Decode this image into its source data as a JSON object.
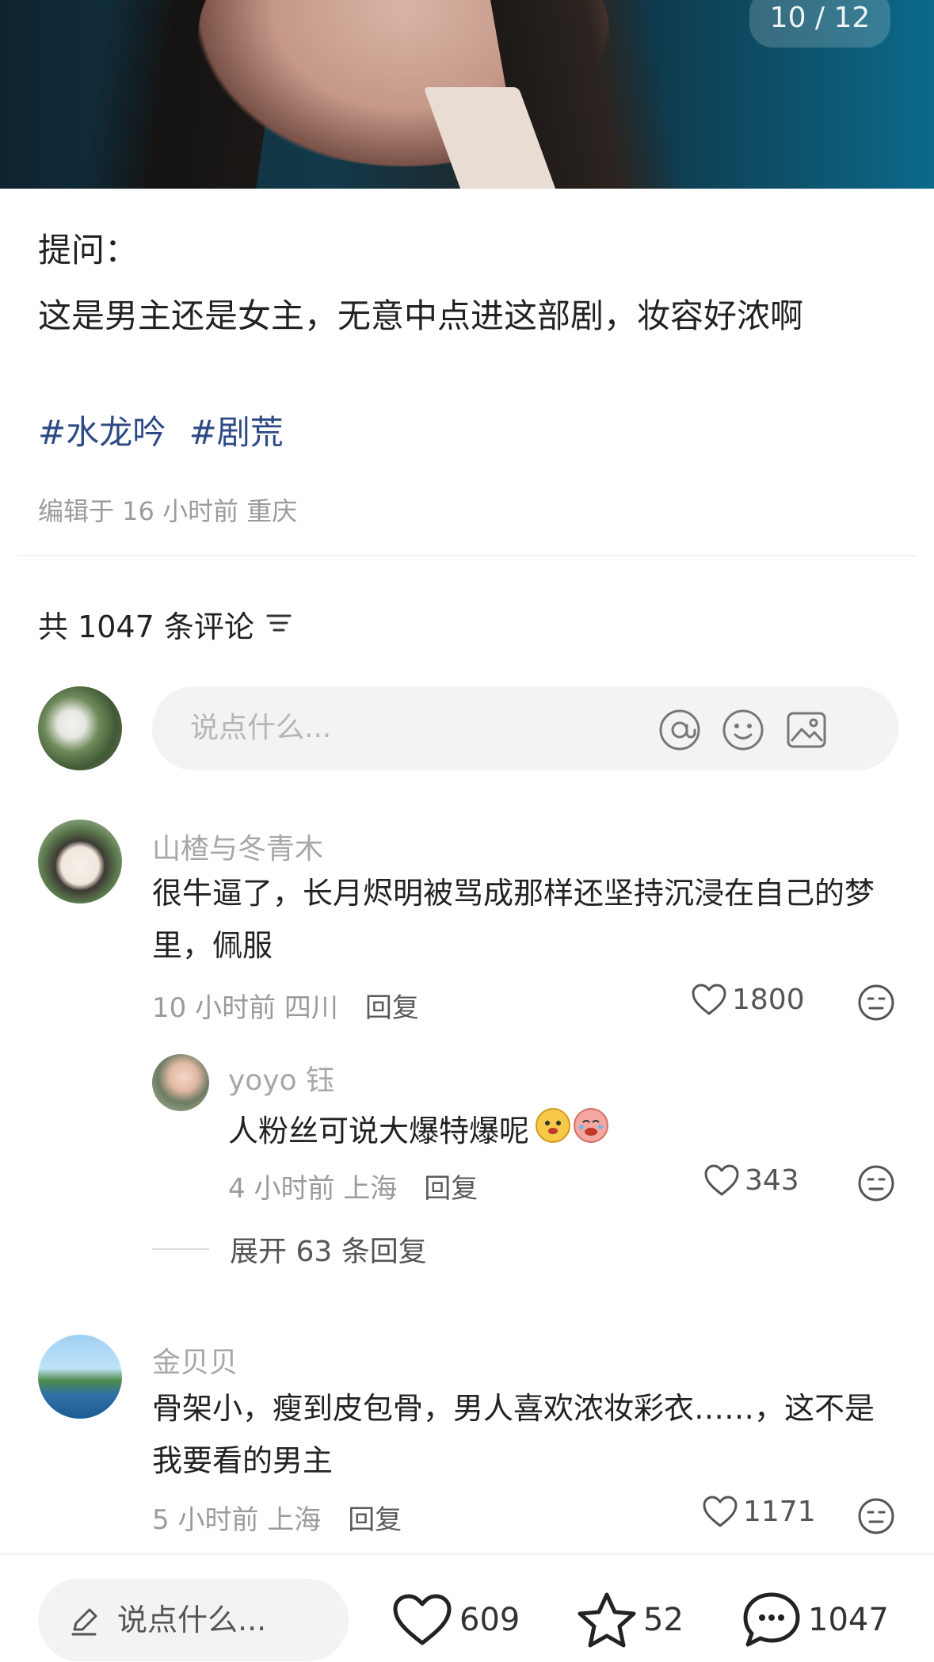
{
  "hero": {
    "page_counter": "10 / 12"
  },
  "post": {
    "label": "提问：",
    "body": "这是男主还是女主，无意中点进这部剧，妆容好浓啊",
    "tags": [
      "#水龙吟",
      "#剧荒"
    ],
    "meta": "编辑于 16 小时前 重庆"
  },
  "comments_header": {
    "title": "共 1047 条评论"
  },
  "comment_input": {
    "placeholder": "说点什么..."
  },
  "comments": [
    {
      "user": "山楂与冬青木",
      "text": "很牛逼了，长月烬明被骂成那样还坚持沉浸在自己的梦里，佩服",
      "time_location": "10 小时前 四川",
      "reply_label": "回复",
      "likes": "1800",
      "reply": {
        "user": "yoyo 钰",
        "text": "人粉丝可说大爆特爆呢",
        "time_location": "4 小时前 上海",
        "reply_label": "回复",
        "likes": "343"
      },
      "expand_label": "展开 63 条回复"
    },
    {
      "user": "金贝贝",
      "text": "骨架小，瘦到皮包骨，男人喜欢浓妆彩衣……，这不是我要看的男主",
      "time_location": "5 小时前 上海",
      "reply_label": "回复",
      "likes": "1171"
    }
  ],
  "bottom_bar": {
    "input_placeholder": "说点什么...",
    "likes": "609",
    "favorites": "52",
    "comments": "1047"
  }
}
